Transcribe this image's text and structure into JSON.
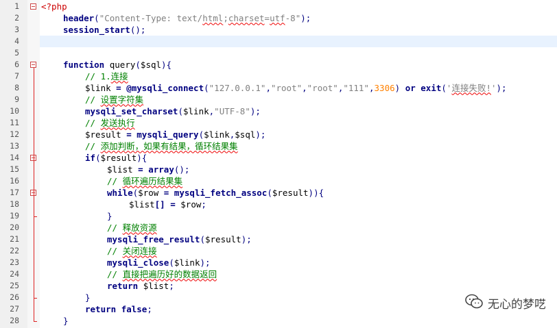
{
  "editor": {
    "current_line": 4,
    "lines": [
      {
        "n": "1",
        "indent": 0,
        "fold": "open",
        "tokens": [
          {
            "t": "<?php",
            "c": "tag"
          }
        ]
      },
      {
        "n": "2",
        "indent": 1,
        "tokens": [
          {
            "t": "header",
            "c": "func"
          },
          {
            "t": "(",
            "c": "punc"
          },
          {
            "t": "\"Content-Type: text/",
            "c": "str"
          },
          {
            "t": "html",
            "c": "str",
            "sq": true
          },
          {
            "t": ";",
            "c": "str"
          },
          {
            "t": "charset",
            "c": "str",
            "sq": true
          },
          {
            "t": "=",
            "c": "str"
          },
          {
            "t": "utf",
            "c": "str",
            "sq": true
          },
          {
            "t": "-8\"",
            "c": "str"
          },
          {
            "t": ");",
            "c": "punc"
          }
        ]
      },
      {
        "n": "3",
        "indent": 1,
        "tokens": [
          {
            "t": "session_start",
            "c": "func"
          },
          {
            "t": "();",
            "c": "punc"
          }
        ]
      },
      {
        "n": "4",
        "indent": 0,
        "tokens": []
      },
      {
        "n": "5",
        "indent": 0,
        "tokens": []
      },
      {
        "n": "6",
        "indent": 1,
        "fold": "open",
        "tokens": [
          {
            "t": "function",
            "c": "kw"
          },
          {
            "t": " ",
            "c": "plain"
          },
          {
            "t": "query",
            "c": "plain"
          },
          {
            "t": "(",
            "c": "punc"
          },
          {
            "t": "$sql",
            "c": "var"
          },
          {
            "t": "){",
            "c": "punc"
          }
        ]
      },
      {
        "n": "7",
        "indent": 2,
        "tokens": [
          {
            "t": "// 1.",
            "c": "com"
          },
          {
            "t": "连接",
            "c": "com",
            "sq": true
          }
        ]
      },
      {
        "n": "8",
        "indent": 2,
        "tokens": [
          {
            "t": "$link",
            "c": "var"
          },
          {
            "t": " = ",
            "c": "op"
          },
          {
            "t": "@",
            "c": "op"
          },
          {
            "t": "mysqli_connect",
            "c": "func"
          },
          {
            "t": "(",
            "c": "punc"
          },
          {
            "t": "\"127.0.0.1\"",
            "c": "str"
          },
          {
            "t": ",",
            "c": "punc"
          },
          {
            "t": "\"root\"",
            "c": "str"
          },
          {
            "t": ",",
            "c": "punc"
          },
          {
            "t": "\"root\"",
            "c": "str"
          },
          {
            "t": ",",
            "c": "punc"
          },
          {
            "t": "\"111\"",
            "c": "str"
          },
          {
            "t": ",",
            "c": "punc"
          },
          {
            "t": "3306",
            "c": "num"
          },
          {
            "t": ") ",
            "c": "punc"
          },
          {
            "t": "or",
            "c": "kw"
          },
          {
            "t": " ",
            "c": "plain"
          },
          {
            "t": "exit",
            "c": "kw"
          },
          {
            "t": "(",
            "c": "punc"
          },
          {
            "t": "'",
            "c": "str"
          },
          {
            "t": "连接失败!",
            "c": "str",
            "sq": true
          },
          {
            "t": "'",
            "c": "str"
          },
          {
            "t": ");",
            "c": "punc"
          }
        ]
      },
      {
        "n": "9",
        "indent": 2,
        "tokens": [
          {
            "t": "// ",
            "c": "com"
          },
          {
            "t": "设置字符集",
            "c": "com",
            "sq": true
          }
        ]
      },
      {
        "n": "10",
        "indent": 2,
        "tokens": [
          {
            "t": "mysqli_set_charset",
            "c": "func"
          },
          {
            "t": "(",
            "c": "punc"
          },
          {
            "t": "$link",
            "c": "var"
          },
          {
            "t": ",",
            "c": "punc"
          },
          {
            "t": "\"UTF-8\"",
            "c": "str"
          },
          {
            "t": ");",
            "c": "punc"
          }
        ]
      },
      {
        "n": "11",
        "indent": 2,
        "tokens": [
          {
            "t": "// ",
            "c": "com"
          },
          {
            "t": "发送执行",
            "c": "com",
            "sq": true
          }
        ]
      },
      {
        "n": "12",
        "indent": 2,
        "tokens": [
          {
            "t": "$result",
            "c": "var"
          },
          {
            "t": " = ",
            "c": "op"
          },
          {
            "t": "mysqli_query",
            "c": "func"
          },
          {
            "t": "(",
            "c": "punc"
          },
          {
            "t": "$link",
            "c": "var"
          },
          {
            "t": ",",
            "c": "punc"
          },
          {
            "t": "$sql",
            "c": "var"
          },
          {
            "t": ");",
            "c": "punc"
          }
        ]
      },
      {
        "n": "13",
        "indent": 2,
        "tokens": [
          {
            "t": "// ",
            "c": "com"
          },
          {
            "t": "添加判断，如果有结果，循环结果集",
            "c": "com",
            "sq": true
          }
        ]
      },
      {
        "n": "14",
        "indent": 2,
        "fold": "open",
        "tokens": [
          {
            "t": "if",
            "c": "kw"
          },
          {
            "t": "(",
            "c": "punc"
          },
          {
            "t": "$result",
            "c": "var"
          },
          {
            "t": "){",
            "c": "punc"
          }
        ]
      },
      {
        "n": "15",
        "indent": 3,
        "tokens": [
          {
            "t": "$list",
            "c": "var"
          },
          {
            "t": " = ",
            "c": "op"
          },
          {
            "t": "array",
            "c": "func"
          },
          {
            "t": "();",
            "c": "punc"
          }
        ]
      },
      {
        "n": "16",
        "indent": 3,
        "tokens": [
          {
            "t": "// ",
            "c": "com"
          },
          {
            "t": "循环遍历结果集",
            "c": "com",
            "sq": true
          }
        ]
      },
      {
        "n": "17",
        "indent": 3,
        "fold": "open",
        "tokens": [
          {
            "t": "while",
            "c": "kw"
          },
          {
            "t": "(",
            "c": "punc"
          },
          {
            "t": "$row",
            "c": "var"
          },
          {
            "t": " = ",
            "c": "op"
          },
          {
            "t": "mysqli_fetch_assoc",
            "c": "func"
          },
          {
            "t": "(",
            "c": "punc"
          },
          {
            "t": "$result",
            "c": "var"
          },
          {
            "t": ")){",
            "c": "punc"
          }
        ]
      },
      {
        "n": "18",
        "indent": 4,
        "tokens": [
          {
            "t": "$list",
            "c": "var"
          },
          {
            "t": "[] = ",
            "c": "op"
          },
          {
            "t": "$row",
            "c": "var"
          },
          {
            "t": ";",
            "c": "punc"
          }
        ]
      },
      {
        "n": "19",
        "indent": 3,
        "fold": "end",
        "tokens": [
          {
            "t": "}",
            "c": "punc"
          }
        ]
      },
      {
        "n": "20",
        "indent": 3,
        "tokens": [
          {
            "t": "// ",
            "c": "com"
          },
          {
            "t": "释放资源",
            "c": "com",
            "sq": true
          }
        ]
      },
      {
        "n": "21",
        "indent": 3,
        "tokens": [
          {
            "t": "mysqli_free_result",
            "c": "func"
          },
          {
            "t": "(",
            "c": "punc"
          },
          {
            "t": "$result",
            "c": "var"
          },
          {
            "t": ");",
            "c": "punc"
          }
        ]
      },
      {
        "n": "22",
        "indent": 3,
        "tokens": [
          {
            "t": "// ",
            "c": "com"
          },
          {
            "t": "关闭连接",
            "c": "com",
            "sq": true
          }
        ]
      },
      {
        "n": "23",
        "indent": 3,
        "tokens": [
          {
            "t": "mysqli_close",
            "c": "func"
          },
          {
            "t": "(",
            "c": "punc"
          },
          {
            "t": "$link",
            "c": "var"
          },
          {
            "t": ");",
            "c": "punc"
          }
        ]
      },
      {
        "n": "24",
        "indent": 3,
        "tokens": [
          {
            "t": "// ",
            "c": "com"
          },
          {
            "t": "直接把遍历好的数据返回",
            "c": "com",
            "sq": true
          }
        ]
      },
      {
        "n": "25",
        "indent": 3,
        "tokens": [
          {
            "t": "return",
            "c": "kw"
          },
          {
            "t": " ",
            "c": "plain"
          },
          {
            "t": "$list",
            "c": "var"
          },
          {
            "t": ";",
            "c": "punc"
          }
        ]
      },
      {
        "n": "26",
        "indent": 2,
        "fold": "end",
        "tokens": [
          {
            "t": "}",
            "c": "punc"
          }
        ]
      },
      {
        "n": "27",
        "indent": 2,
        "tokens": [
          {
            "t": "return",
            "c": "kw"
          },
          {
            "t": " ",
            "c": "plain"
          },
          {
            "t": "false",
            "c": "kw"
          },
          {
            "t": ";",
            "c": "punc"
          }
        ]
      },
      {
        "n": "28",
        "indent": 1,
        "fold": "end",
        "tokens": [
          {
            "t": "}",
            "c": "punc"
          }
        ]
      }
    ]
  },
  "watermark": {
    "text": "无心的梦呓",
    "icon": "wechat-icon"
  }
}
